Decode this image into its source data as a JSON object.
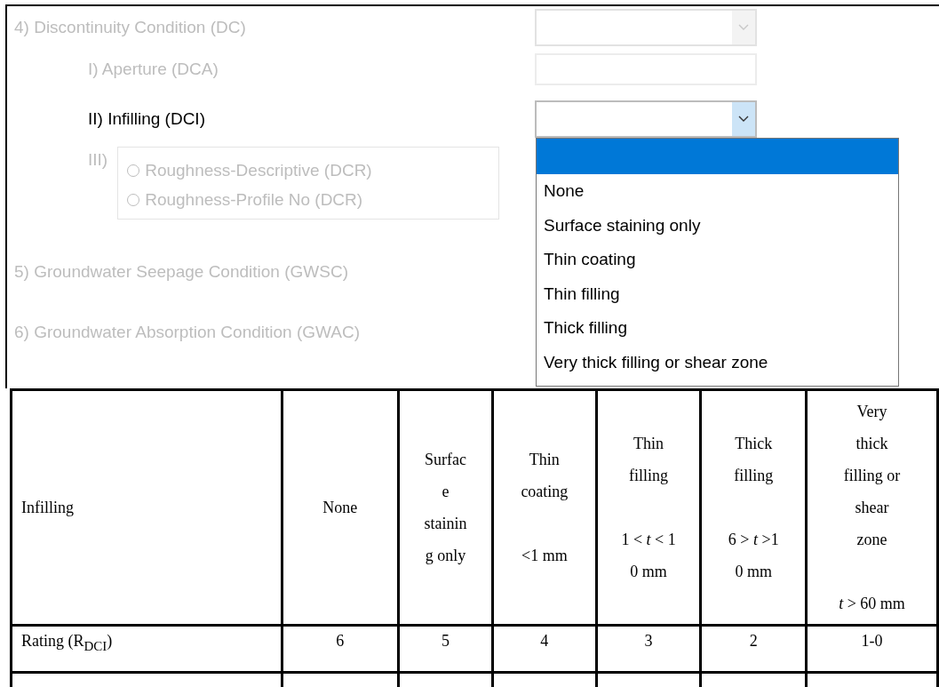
{
  "form": {
    "sections": [
      {
        "label": "4) Discontinuity Condition (DC)",
        "disabled": true,
        "control": {
          "kind": "select",
          "disabled": true
        },
        "children": [
          {
            "label": "I) Aperture (DCA)",
            "disabled": true,
            "control": {
              "kind": "input",
              "disabled": true
            }
          },
          {
            "label": "II) Infilling (DCI)",
            "disabled": false,
            "control": {
              "kind": "select",
              "disabled": false,
              "open": true,
              "blank_option_highlighted": true,
              "options": [
                {
                  "label": "None",
                  "selected": false
                },
                {
                  "label": "Surface staining only",
                  "selected": false
                },
                {
                  "label": "Thin coating",
                  "selected": false
                },
                {
                  "label": "Thin filling",
                  "selected": false
                },
                {
                  "label": "Thick filling",
                  "selected": false
                },
                {
                  "label": "Very thick filling or shear zone",
                  "selected": false
                }
              ]
            }
          },
          {
            "label": "III)",
            "disabled": true,
            "control": {
              "kind": "radio_group",
              "disabled": true,
              "options": [
                {
                  "label": "Roughness-Descriptive (DCR)",
                  "selected": false
                },
                {
                  "label": "Roughness-Profile No (DCR)",
                  "selected": false
                }
              ]
            }
          }
        ]
      },
      {
        "label": "5) Groundwater Seepage Condition (GWSC)",
        "disabled": true
      },
      {
        "label": "6) Groundwater Absorption Condition (GWAC)",
        "disabled": true
      }
    ]
  },
  "table": {
    "header": [
      {
        "name_lines": [
          "Infilling"
        ]
      },
      {
        "name_lines": [
          "None"
        ]
      },
      {
        "name_lines": [
          "Surfac",
          "e",
          "stainin",
          "g only"
        ]
      },
      {
        "name_lines": [
          "Thin",
          "coating"
        ],
        "range_lines": [
          "<1 mm"
        ]
      },
      {
        "name_lines": [
          "Thin",
          "filling"
        ],
        "range_lines": [
          "1 < *t* < 1",
          "0 mm"
        ]
      },
      {
        "name_lines": [
          "Thick",
          "filling"
        ],
        "range_lines": [
          "6 > *t* >1",
          "0 mm"
        ]
      },
      {
        "name_lines": [
          "Very",
          "thick",
          "filling or",
          "shear",
          "zone"
        ],
        "range_lines": [
          "*t* > 60 mm"
        ]
      }
    ],
    "rows": [
      {
        "cells": [
          "Rating (R$_{DCI}$)",
          "6",
          "5",
          "4",
          "3",
          "2",
          "1-0"
        ]
      }
    ]
  }
}
